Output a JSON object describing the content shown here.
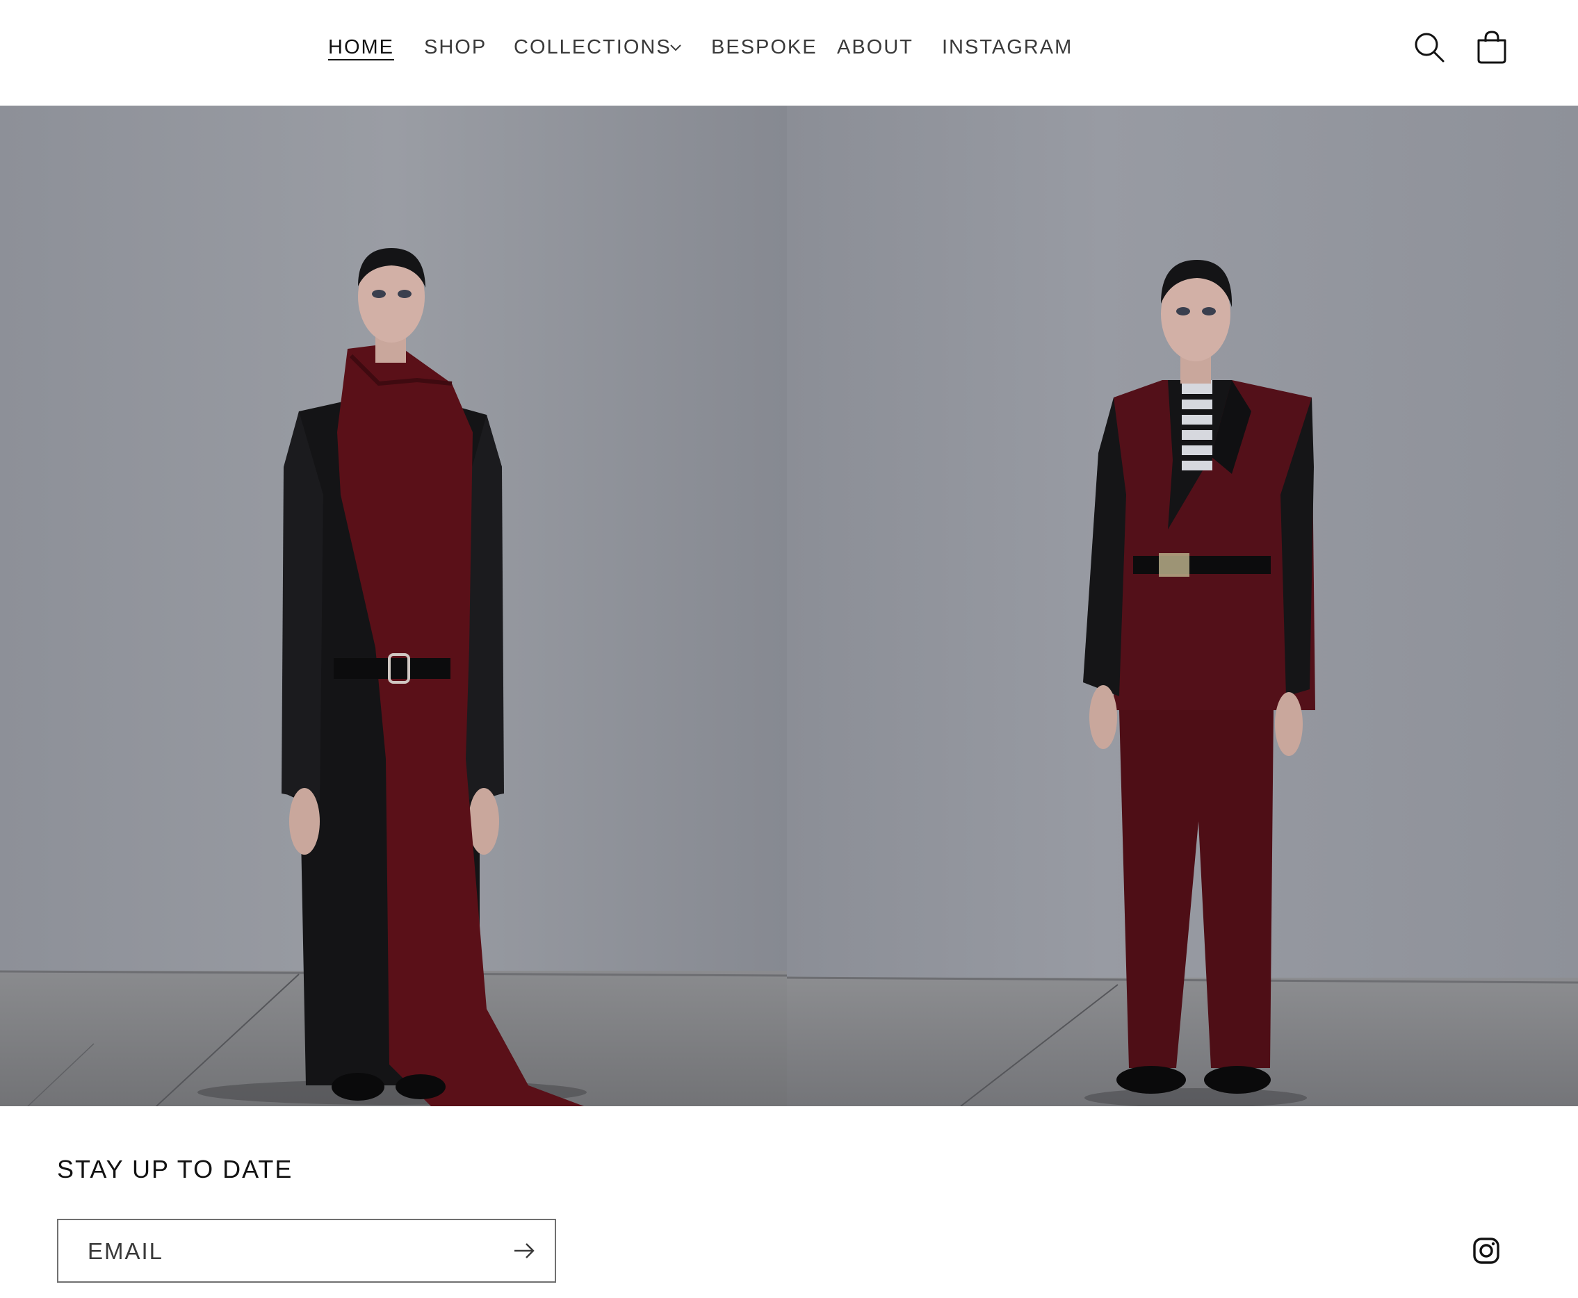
{
  "header": {
    "nav": [
      {
        "label": "HOME",
        "active": true
      },
      {
        "label": "SHOP"
      },
      {
        "label": "COLLECTIONS",
        "has_dropdown": true
      },
      {
        "label": "BESPOKE"
      },
      {
        "label": "ABOUT"
      },
      {
        "label": "INSTAGRAM"
      }
    ],
    "icons": {
      "search": "search-icon",
      "cart": "cart-icon",
      "dropdown": "chevron-down-icon"
    }
  },
  "hero": {
    "images": [
      {
        "description": "model-in-black-coat-with-burgundy-scarf"
      },
      {
        "description": "model-in-burgundy-suit-with-black-sleeves"
      }
    ]
  },
  "footer": {
    "newsletter_heading": "STAY UP TO DATE",
    "email_placeholder": "EMAIL",
    "icons": {
      "submit": "arrow-right-icon",
      "social": "instagram-icon"
    }
  },
  "colors": {
    "burgundy": "#5a1018",
    "black": "#141416",
    "wall": "#8a8d95",
    "floor": "#7c7d80"
  }
}
